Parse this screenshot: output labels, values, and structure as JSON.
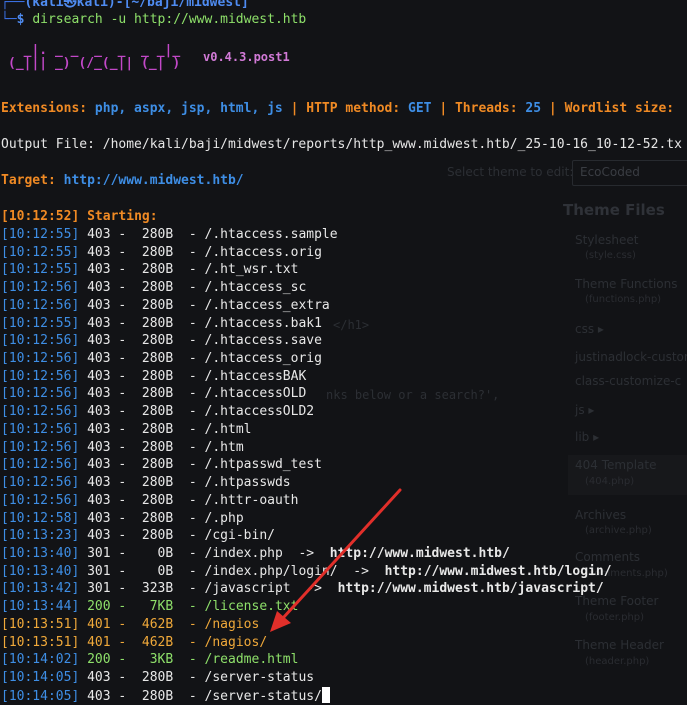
{
  "prompt": {
    "line1": "(kali㉿kali)-[~/baji/midwest]",
    "symbol": "$",
    "command": "dirsearch -u http://www.midwest.htb"
  },
  "version": "v0.4.3.post1",
  "extensions_line": {
    "ext_label": "Extensions:",
    "ext_value": "php, aspx, jsp, html, js",
    "method_label": "HTTP method:",
    "method_value": "GET",
    "threads_label": "Threads:",
    "threads_value": "25",
    "wordlist_label": "Wordlist size:"
  },
  "output_file": "Output File: /home/kali/baji/midwest/reports/http_www.midwest.htb/_25-10-16_10-12-52.tx",
  "target": {
    "label": "Target:",
    "value": "http://www.midwest.htb/"
  },
  "starting": {
    "time": "[10:12:52]",
    "text": "Starting:"
  },
  "results": [
    {
      "time": "[10:12:55]",
      "code": "403",
      "size": "280B",
      "path": "/.htaccess.sample"
    },
    {
      "time": "[10:12:55]",
      "code": "403",
      "size": "280B",
      "path": "/.htaccess.orig"
    },
    {
      "time": "[10:12:55]",
      "code": "403",
      "size": "280B",
      "path": "/.ht_wsr.txt"
    },
    {
      "time": "[10:12:56]",
      "code": "403",
      "size": "280B",
      "path": "/.htaccess_sc"
    },
    {
      "time": "[10:12:56]",
      "code": "403",
      "size": "280B",
      "path": "/.htaccess_extra"
    },
    {
      "time": "[10:12:55]",
      "code": "403",
      "size": "280B",
      "path": "/.htaccess.bak1"
    },
    {
      "time": "[10:12:56]",
      "code": "403",
      "size": "280B",
      "path": "/.htaccess.save"
    },
    {
      "time": "[10:12:56]",
      "code": "403",
      "size": "280B",
      "path": "/.htaccess_orig"
    },
    {
      "time": "[10:12:56]",
      "code": "403",
      "size": "280B",
      "path": "/.htaccessBAK"
    },
    {
      "time": "[10:12:56]",
      "code": "403",
      "size": "280B",
      "path": "/.htaccessOLD"
    },
    {
      "time": "[10:12:56]",
      "code": "403",
      "size": "280B",
      "path": "/.htaccessOLD2"
    },
    {
      "time": "[10:12:56]",
      "code": "403",
      "size": "280B",
      "path": "/.html"
    },
    {
      "time": "[10:12:56]",
      "code": "403",
      "size": "280B",
      "path": "/.htm"
    },
    {
      "time": "[10:12:56]",
      "code": "403",
      "size": "280B",
      "path": "/.htpasswd_test"
    },
    {
      "time": "[10:12:56]",
      "code": "403",
      "size": "280B",
      "path": "/.htpasswds"
    },
    {
      "time": "[10:12:56]",
      "code": "403",
      "size": "280B",
      "path": "/.httr-oauth"
    },
    {
      "time": "[10:12:58]",
      "code": "403",
      "size": "280B",
      "path": "/.php"
    },
    {
      "time": "[10:13:23]",
      "code": "403",
      "size": "280B",
      "path": "/cgi-bin/"
    },
    {
      "time": "[10:13:40]",
      "code": "301",
      "size": "0B",
      "path": "/index.php",
      "redirect": "http://www.midwest.htb/"
    },
    {
      "time": "[10:13:40]",
      "code": "301",
      "size": "0B",
      "path": "/index.php/login/",
      "redirect": "http://www.midwest.htb/login/"
    },
    {
      "time": "[10:13:42]",
      "code": "301",
      "size": "323B",
      "path": "/javascript",
      "redirect": "http://www.midwest.htb/javascript/"
    },
    {
      "time": "[10:13:44]",
      "code": "200",
      "size": "7KB",
      "path": "/license.txt"
    },
    {
      "time": "[10:13:51]",
      "code": "401",
      "size": "462B",
      "path": "/nagios"
    },
    {
      "time": "[10:13:51]",
      "code": "401",
      "size": "462B",
      "path": "/nagios/"
    },
    {
      "time": "[10:14:02]",
      "code": "200",
      "size": "3KB",
      "path": "/readme.html"
    },
    {
      "time": "[10:14:05]",
      "code": "403",
      "size": "280B",
      "path": "/server-status"
    },
    {
      "time": "[10:14:05]",
      "code": "403",
      "size": "280B",
      "path": "/server-status/"
    }
  ],
  "redirect_arrow": "->",
  "ghost": {
    "select_label": "Select theme to edit:",
    "select_value": "EcoCoded",
    "theme_files": "Theme Files",
    "items": [
      {
        "name": "Stylesheet",
        "file": "(style.css)"
      },
      {
        "name": "Theme Functions",
        "file": "(functions.php)"
      },
      {
        "name": "css ▸",
        "file": ""
      },
      {
        "name": "justinadlock-customizer",
        "file": ""
      },
      {
        "name": "class-customize-c",
        "file": ""
      },
      {
        "name": "js ▸",
        "file": ""
      },
      {
        "name": "lib ▸",
        "file": ""
      },
      {
        "name": "404 Template",
        "file": "(404.php)"
      },
      {
        "name": "Archives",
        "file": "(archive.php)"
      },
      {
        "name": "Comments",
        "file": "(comments.php)"
      },
      {
        "name": "Theme Footer",
        "file": "(footer.php)"
      },
      {
        "name": "Theme Header",
        "file": "(header.php)"
      }
    ],
    "code1": "</h1>",
    "code2": "nks below or a search?',"
  },
  "colors": {
    "background": "#121316",
    "timestamp": "#3e8ee5",
    "orange": "#f08a24",
    "status_401": "#f0a93a",
    "arrow": "#e12f2a"
  }
}
